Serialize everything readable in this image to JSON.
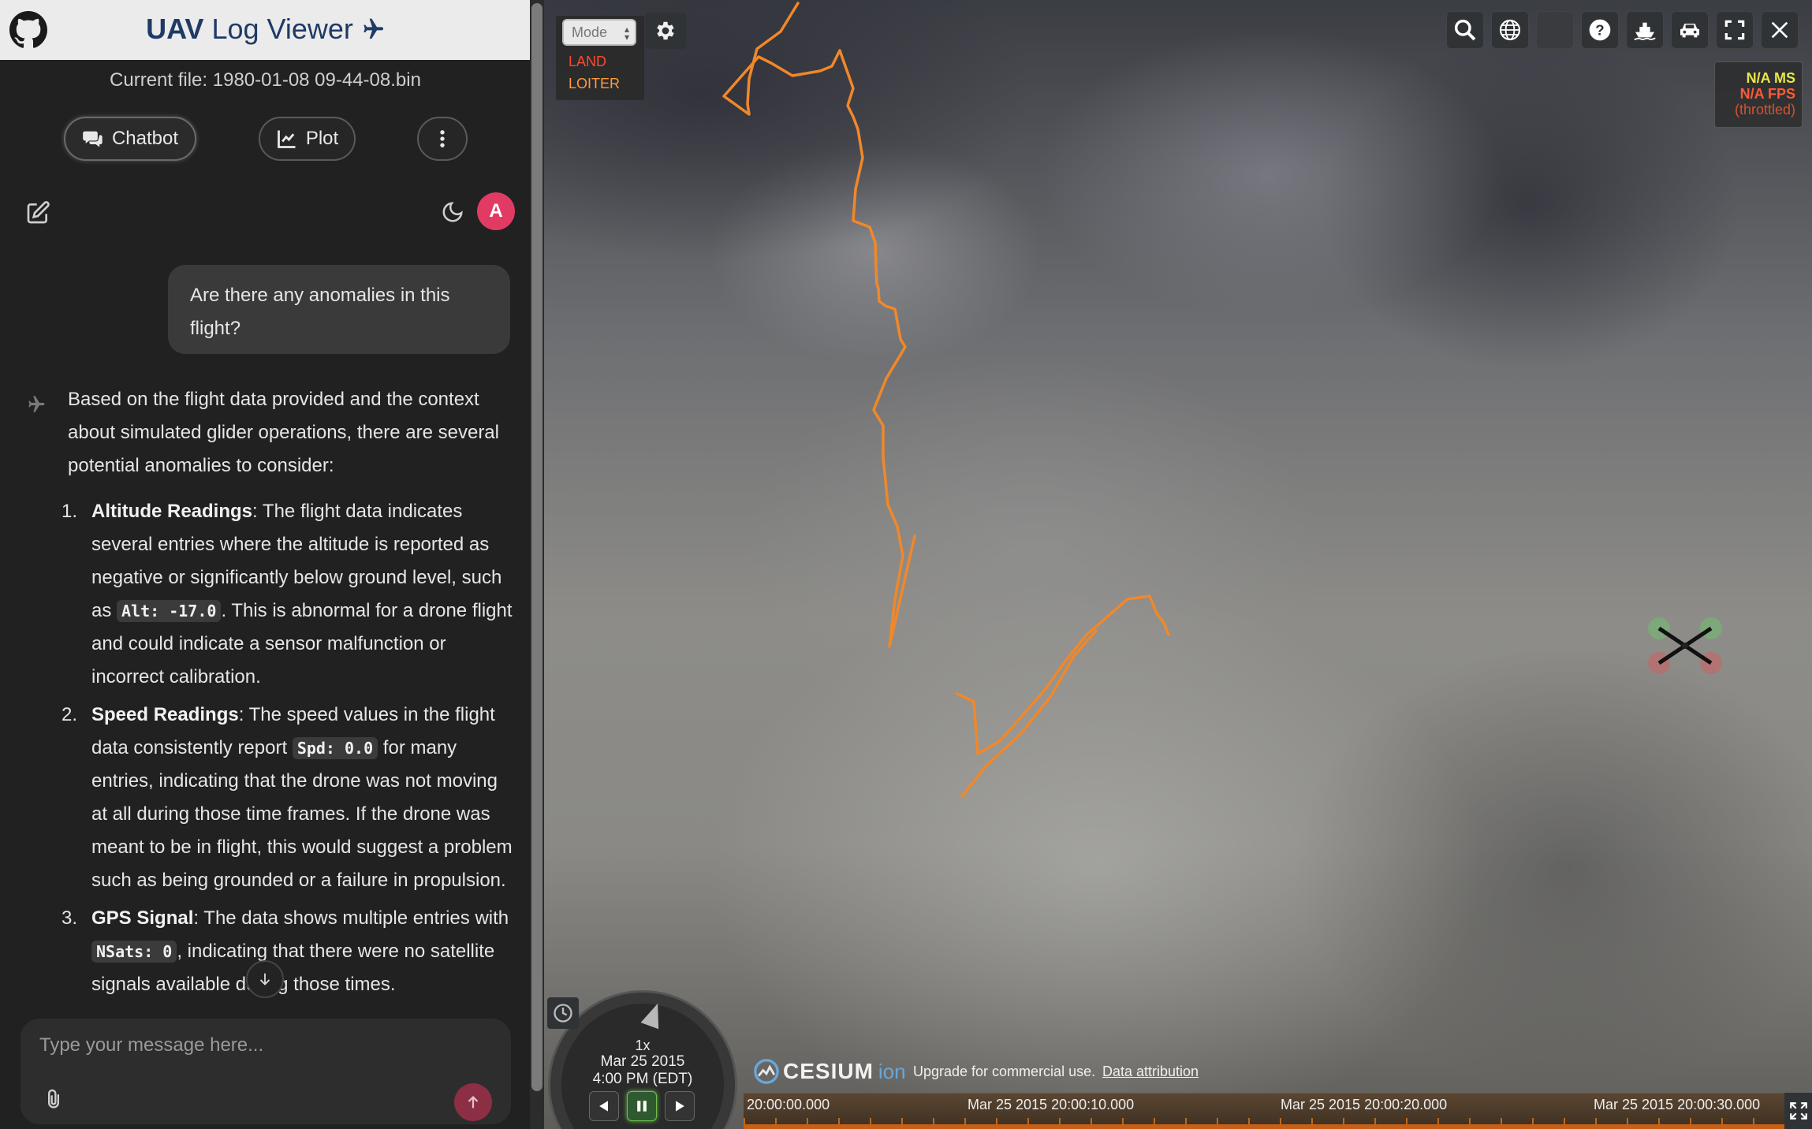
{
  "header": {
    "title_bold": "UAV",
    "title_rest": " Log Viewer"
  },
  "current_file": "Current file: 1980-01-08 09-44-08.bin",
  "tabs": {
    "chatbot": "Chatbot",
    "plot": "Plot"
  },
  "user": {
    "avatar_letter": "A"
  },
  "chat": {
    "user_message": "Are there any anomalies in this flight?",
    "bot_intro": "Based on the flight data provided and the context about simulated glider operations, there are several potential anomalies to consider:",
    "items": [
      {
        "num": "1.",
        "title": "Altitude Readings",
        "text_a": ": The flight data indicates several entries where the altitude is reported as negative or significantly below ground level, such as ",
        "code": "Alt: -17.0",
        "text_b": ". This is abnormal for a drone flight and could indicate a sensor malfunction or incorrect calibration."
      },
      {
        "num": "2.",
        "title": "Speed Readings",
        "text_a": ": The speed values in the flight data consistently report ",
        "code": "Spd: 0.0",
        "text_b": " for many entries, indicating that the drone was not moving at all during those time frames. If the drone was meant to be in flight, this would suggest a problem such as being grounded or a failure in propulsion."
      },
      {
        "num": "3.",
        "title": "GPS Signal",
        "text_a": ": The data shows multiple entries with ",
        "code": "NSats: 0",
        "text_b": ", indicating that there were no satellite signals available during those times."
      }
    ]
  },
  "input": {
    "placeholder": "Type your message here..."
  },
  "map": {
    "mode_select": "Mode",
    "modes": [
      "LAND",
      "LOITER"
    ],
    "mode_colors": [
      "#ff4a2c",
      "#ff9b3a"
    ],
    "perf": {
      "ms": "N/A MS",
      "fps": "N/A FPS",
      "throttled": "(throttled)"
    },
    "animation": {
      "speed": "1x",
      "date": "Mar 25 2015",
      "time": "4:00 PM (EDT)"
    },
    "cesium": {
      "word": "CESIUM",
      "ion": "ion"
    },
    "credit_text": "Upgrade for commercial use.",
    "credit_link": "Data attribution",
    "timeline_labels": [
      "20:00:00.000",
      "Mar 25 2015 20:00:10.000",
      "Mar 25 2015 20:00:20.000",
      "Mar 25 2015 20:00:30.000"
    ],
    "track_color": "#f0882a"
  },
  "icons": {
    "github": "github-icon",
    "plane": "airplane-icon",
    "chat": "chat-bubbles-icon",
    "plot": "line-chart-icon",
    "more": "vertical-dots-icon",
    "edit": "edit-icon",
    "moon": "moon-icon",
    "clip": "paperclip-icon",
    "send": "arrow-up-icon",
    "down": "arrow-down-icon"
  }
}
